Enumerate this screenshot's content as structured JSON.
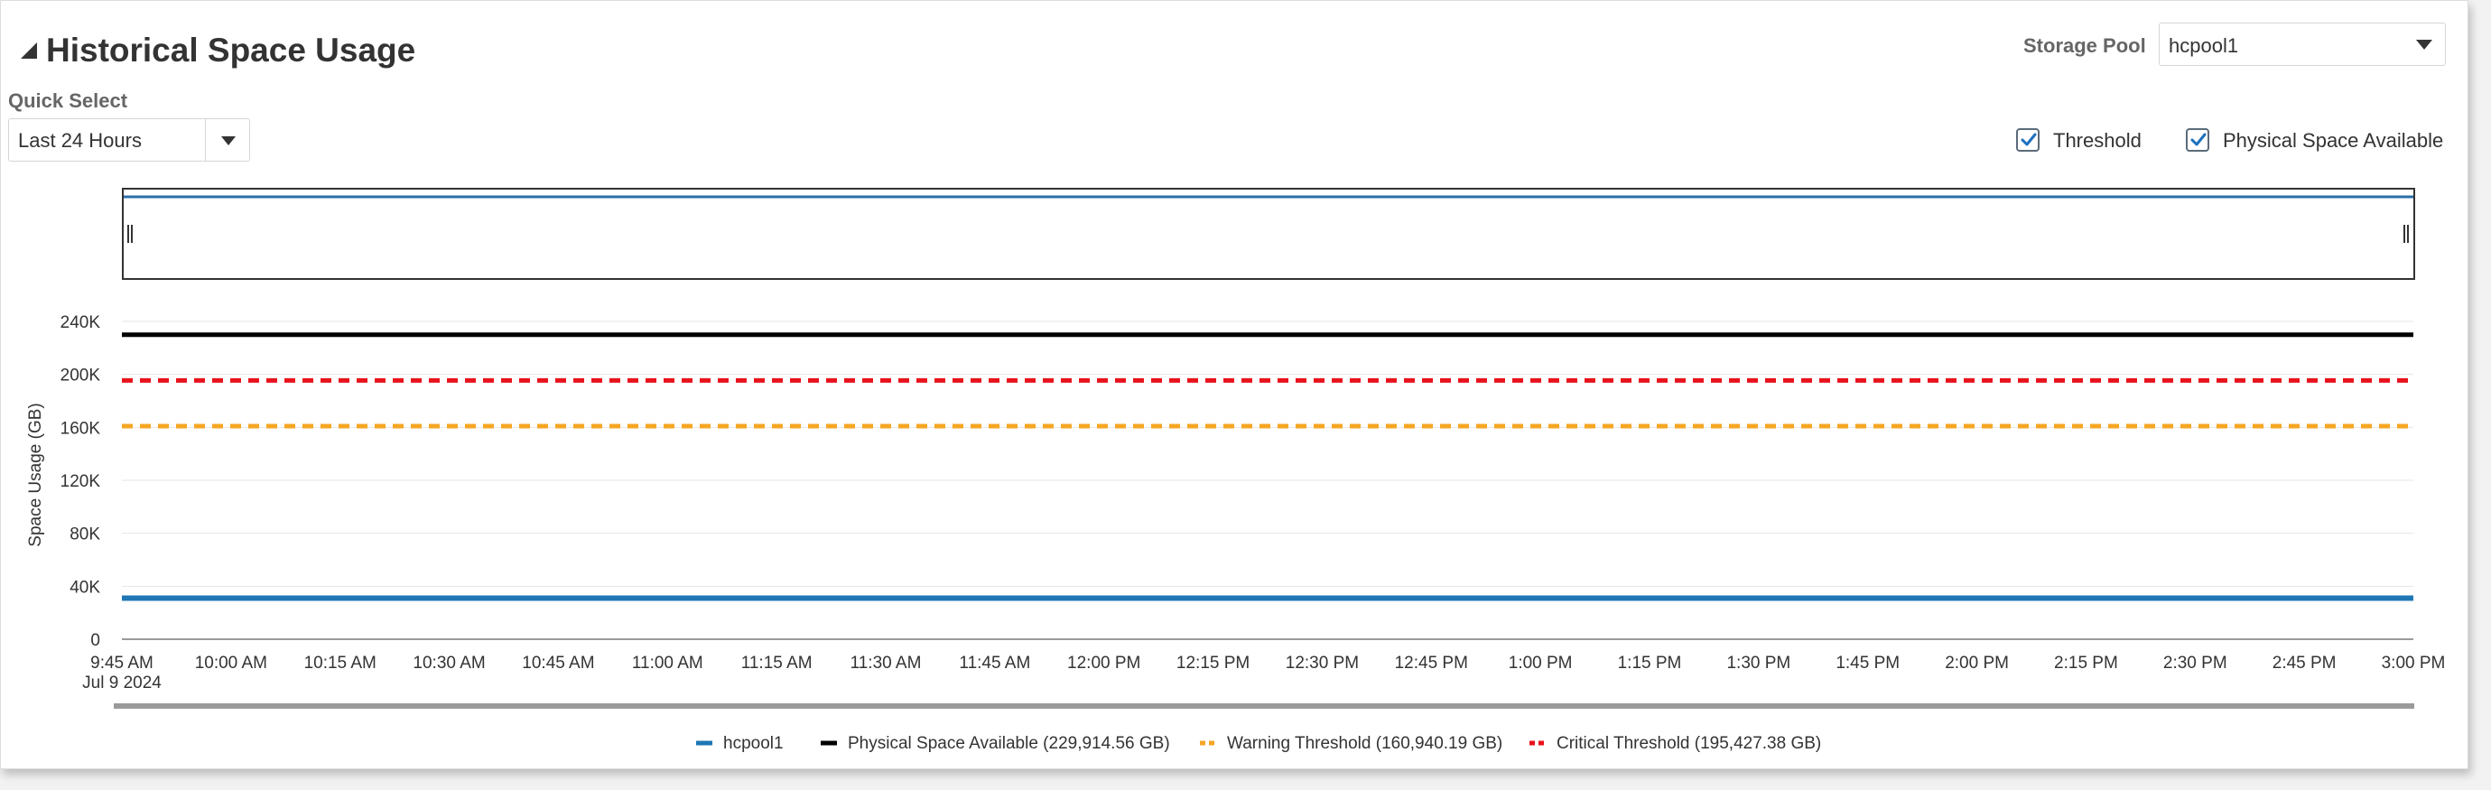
{
  "header": {
    "title": "Historical Space Usage",
    "quick_select_label": "Quick Select",
    "quick_select_value": "Last 24 Hours",
    "storage_pool_label": "Storage Pool",
    "storage_pool_value": "hcpool1",
    "threshold_label": "Threshold",
    "threshold_checked": true,
    "physical_space_label": "Physical Space Available",
    "physical_space_checked": true
  },
  "icons": {
    "collapse": "collapse-triangle-icon",
    "dropdown": "caret-down-icon",
    "checkbox": "checkmark-icon",
    "overview_handle": "drag-handle-icon"
  },
  "colors": {
    "hcpool1": "#1f77b4",
    "physical": "#000000",
    "warning": "#f5a623",
    "critical": "#e8121c",
    "overview_line": "#2a6ea8"
  },
  "chart_data": {
    "type": "line",
    "ylabel": "Space Usage (GB)",
    "xlabel": "",
    "ylim": [
      0,
      240000
    ],
    "y_ticks": [
      "0",
      "40K",
      "80K",
      "120K",
      "160K",
      "200K",
      "240K"
    ],
    "x_ticks": [
      "9:45 AM",
      "10:00 AM",
      "10:15 AM",
      "10:30 AM",
      "10:45 AM",
      "11:00 AM",
      "11:15 AM",
      "11:30 AM",
      "11:45 AM",
      "12:00 PM",
      "12:15 PM",
      "12:30 PM",
      "12:45 PM",
      "1:00 PM",
      "1:15 PM",
      "1:30 PM",
      "1:45 PM",
      "2:00 PM",
      "2:15 PM",
      "2:30 PM",
      "2:45 PM",
      "3:00 PM"
    ],
    "x_date_label": "Jul 9 2024",
    "grid": true,
    "legend_position": "bottom",
    "series": [
      {
        "name": "hcpool1",
        "style": "solid",
        "values": [
          31000,
          31000
        ]
      },
      {
        "name": "Physical Space Available (229,914.56 GB)",
        "style": "solid",
        "values": [
          229914.56,
          229914.56
        ]
      },
      {
        "name": "Warning Threshold (160,940.19 GB)",
        "style": "dashed",
        "values": [
          160940.19,
          160940.19
        ]
      },
      {
        "name": "Critical Threshold (195,427.38 GB)",
        "style": "dashed",
        "values": [
          195427.38,
          195427.38
        ]
      }
    ],
    "x": [
      "9:45 AM",
      "3:00 PM"
    ]
  }
}
